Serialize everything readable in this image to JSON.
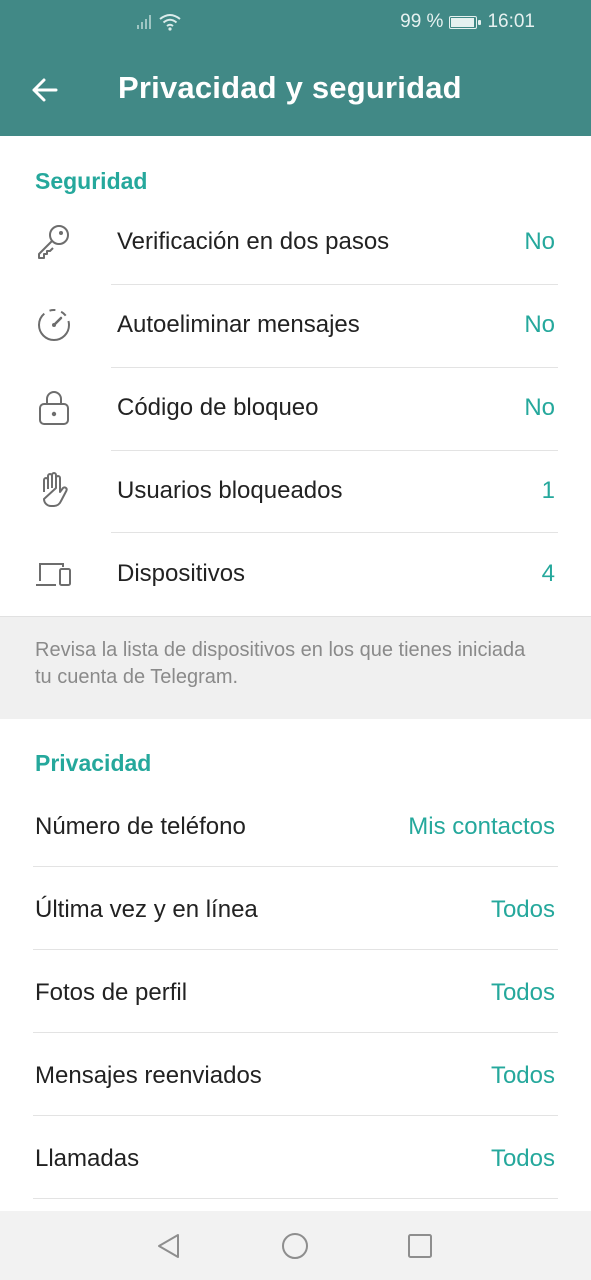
{
  "status_bar": {
    "battery_text": "99 %",
    "battery_level": 0.99,
    "time": "16:01",
    "icons": [
      "signal-icon",
      "wifi-icon",
      "battery-icon"
    ]
  },
  "app_bar": {
    "title": "Privacidad y seguridad",
    "background": "#418986",
    "back_icon": "back-arrow-icon"
  },
  "security": {
    "header": "Seguridad",
    "items": [
      {
        "label": "Verificación en dos pasos",
        "value": "No",
        "icon": "key-icon"
      },
      {
        "label": "Autoeliminar mensajes",
        "value": "No",
        "icon": "timer-icon"
      },
      {
        "label": "Código de bloqueo",
        "value": "No",
        "icon": "lock-icon"
      },
      {
        "label": "Usuarios bloqueados",
        "value": "1",
        "icon": "hand-icon"
      },
      {
        "label": "Dispositivos",
        "value": "4",
        "icon": "devices-icon"
      }
    ]
  },
  "devices_info": "Revisa la lista de dispositivos en los que tienes iniciada tu cuenta de Telegram.",
  "privacy": {
    "header": "Privacidad",
    "items": [
      {
        "label": "Número de teléfono",
        "value": "Mis contactos"
      },
      {
        "label": "Última vez y en línea",
        "value": "Todos"
      },
      {
        "label": "Fotos de perfil",
        "value": "Todos"
      },
      {
        "label": "Mensajes reenviados",
        "value": "Todos"
      },
      {
        "label": "Llamadas",
        "value": "Todos"
      }
    ]
  },
  "colors": {
    "accent": "#25a89c",
    "header": "#418986",
    "text": "#222222",
    "secondary_text": "#8a8a8a"
  },
  "nav_bar": {
    "icons": [
      "nav-back-icon",
      "nav-home-icon",
      "nav-recents-icon"
    ]
  }
}
